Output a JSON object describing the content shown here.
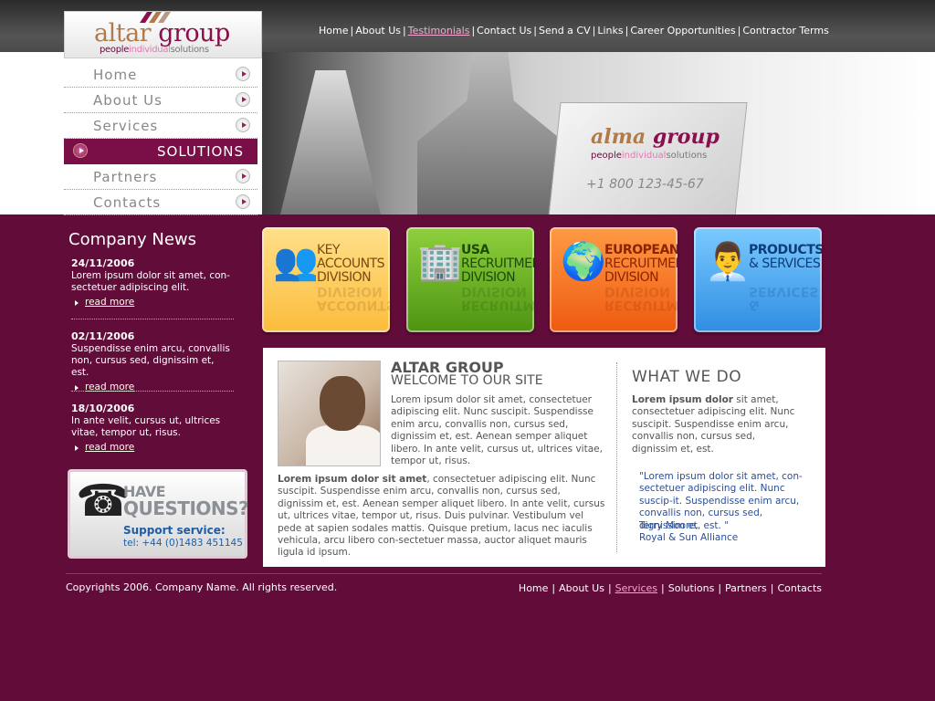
{
  "logo": {
    "word1": "altar",
    "word2": "group",
    "tag1": "people",
    "tag2": "individual",
    "tag3": "solutions"
  },
  "top_nav": [
    {
      "label": "Home",
      "active": false
    },
    {
      "label": "About Us",
      "active": false
    },
    {
      "label": "Testimonials",
      "active": true
    },
    {
      "label": "Contact Us",
      "active": false
    },
    {
      "label": "Send a CV",
      "active": false
    },
    {
      "label": "Links",
      "active": false
    },
    {
      "label": "Career Opportunities",
      "active": false
    },
    {
      "label": "Contractor Terms",
      "active": false
    }
  ],
  "side_menu": [
    {
      "label": "Home",
      "active": false
    },
    {
      "label": "About Us",
      "active": false
    },
    {
      "label": "Services",
      "active": false
    },
    {
      "label": "SOLUTIONS",
      "active": true
    },
    {
      "label": "Partners",
      "active": false
    },
    {
      "label": "Contacts",
      "active": false
    }
  ],
  "hero": {
    "brand1": "alma",
    "brand2": "group",
    "tag1": "people",
    "tag2": "individual",
    "tag3": "solutions",
    "phone": "+1 800 123-45-67"
  },
  "news": {
    "title": "Company News",
    "read_more": "read more",
    "items": [
      {
        "date": "24/11/2006",
        "text": "Lorem ipsum dolor sit amet, con-sectetuer adipiscing elit."
      },
      {
        "date": "02/11/2006",
        "text": "Suspendisse enim arcu, convallis non, cursus sed, dignissim et, est."
      },
      {
        "date": "18/10/2006",
        "text": "In ante velit, cursus ut, ultrices vitae, tempor ut, risus."
      }
    ]
  },
  "questions": {
    "have": "HAVE",
    "questions": "QUESTIONS?",
    "support": "Support service:",
    "tel": "tel: +44 (0)1483 451145"
  },
  "tiles": [
    {
      "line1": "KEY",
      "line2": "ACCOUNTS DIVISION",
      "icon": "people-icon"
    },
    {
      "line1": "USA",
      "line2": "RECRUITMENT DIVISION",
      "icon": "building-icon"
    },
    {
      "line1": "EUROPEAN",
      "line2": "RECRUITMENT DIVISION",
      "icon": "globe-icon"
    },
    {
      "line1": "PRODUCTS",
      "line2": "& SERVICES",
      "icon": "meeting-icon"
    }
  ],
  "main": {
    "title": "ALTAR GROUP",
    "subtitle": "WELCOME TO OUR SITE",
    "para1": "Lorem ipsum dolor sit amet, consectetuer adipiscing elit. Nunc suscipit. Suspendisse enim arcu, convallis non, cursus sed, dignissim et, est. Aenean semper aliquet libero. In ante velit, cursus ut, ultrices vitae, tempor ut, risus.",
    "para2_bold": "Lorem ipsum dolor sit amet",
    "para2": ", consectetuer adipiscing elit. Nunc suscipit. Suspendisse enim arcu, convallis non, cursus sed, dignissim et, est. Aenean semper aliquet libero. In ante velit, cursus ut, ultrices vitae, tempor ut, risus. Duis pulvinar. Vestibulum vel pede at sapien sodales mattis. Quisque pretium, lacus nec iaculis vehicula, arcu libero con-sectetuer massa, auctor aliquet mauris ligula id ipsum."
  },
  "what": {
    "title": "WHAT WE DO",
    "bold": "Lorem ipsum dolor",
    "text": " sit amet, consectetuer adipiscing elit. Nunc suscipit. Suspendisse enim arcu, convallis non, cursus sed, dignissim et, est.",
    "quote": "\"Lorem ipsum dolor sit amet, con-sectetuer adipiscing elit. Nunc suscip-it. Suspendisse enim arcu, convallis non, cursus sed, dignissim et, est. \"",
    "author": "Terry Moore,",
    "company": "Royal & Sun Alliance"
  },
  "footer": {
    "copyright": "Copyrights 2006. Company Name. All rights reserved.",
    "nav": [
      {
        "label": "Home",
        "active": false
      },
      {
        "label": "About Us",
        "active": false
      },
      {
        "label": "Services",
        "active": true
      },
      {
        "label": "Solutions",
        "active": false
      },
      {
        "label": "Partners",
        "active": false
      },
      {
        "label": "Contacts",
        "active": false
      }
    ]
  },
  "colors": {
    "brand": "#8a0f4c",
    "background": "#620c3a",
    "quote": "#2a4f98"
  }
}
